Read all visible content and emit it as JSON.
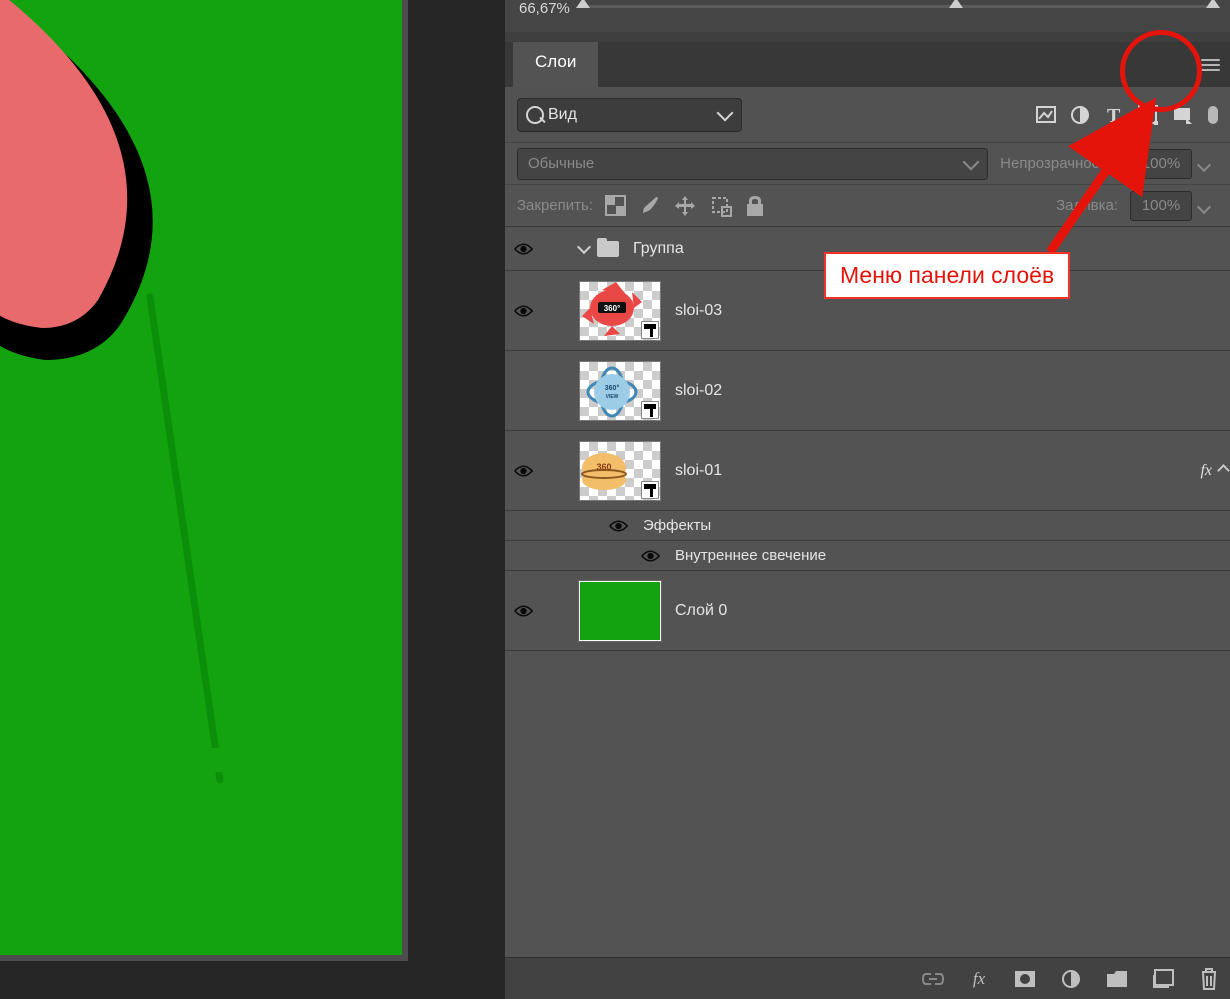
{
  "zoom_value": "66,67%",
  "panel": {
    "tab_label": "Слои",
    "search_label": "Вид",
    "blend_mode": "Обычные",
    "opacity_label": "Непрозрачность:",
    "opacity_value": "100%",
    "lock_label": "Закрепить:",
    "fill_label": "Заливка:",
    "fill_value": "100%"
  },
  "layers": {
    "group_label": "Группа",
    "items": [
      {
        "name": "sloi-03"
      },
      {
        "name": "sloi-02"
      },
      {
        "name": "sloi-01",
        "has_fx": true,
        "fx_label": "fx",
        "effects_label": "Эффекты",
        "effect1": "Внутреннее свечение"
      }
    ],
    "bottom_layer": "Слой 0"
  },
  "annotation_text": "Меню панели слоёв"
}
